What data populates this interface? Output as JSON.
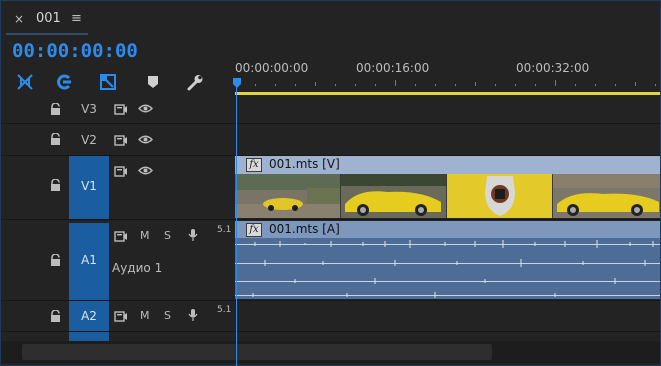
{
  "tab": {
    "close_label": "×",
    "title": "001",
    "menu_label": "≡"
  },
  "timecode": "00:00:00:00",
  "tools": [
    {
      "icon": "snap-icon"
    },
    {
      "icon": "linked-selection-icon"
    },
    {
      "icon": "add-marker-icon"
    },
    {
      "icon": "marker-icon"
    },
    {
      "icon": "wrench-icon"
    }
  ],
  "ruler": {
    "labels": [
      "00:00:00:00",
      "00:00:16:00",
      "00:00:32:00"
    ]
  },
  "tracks": {
    "v3": {
      "label": "V3"
    },
    "v2": {
      "label": "V2"
    },
    "v1": {
      "label": "V1"
    },
    "a1": {
      "label": "A1",
      "name": "Аудио 1",
      "mute": "M",
      "solo": "S",
      "channel": "5.1"
    },
    "a2": {
      "label": "A2",
      "mute": "M",
      "solo": "S",
      "channel": "5.1"
    }
  },
  "clips": {
    "video": {
      "fx": "fx",
      "name": "001.mts [V]"
    },
    "audio": {
      "fx": "fx",
      "name": "001.mts [A]"
    }
  },
  "colors": {
    "accent": "#2d8ceb",
    "work_area": "#e2d63a",
    "target_active": "#1a5da0",
    "video_clip": "#8ea6c8",
    "audio_clip": "#4d6c96"
  }
}
